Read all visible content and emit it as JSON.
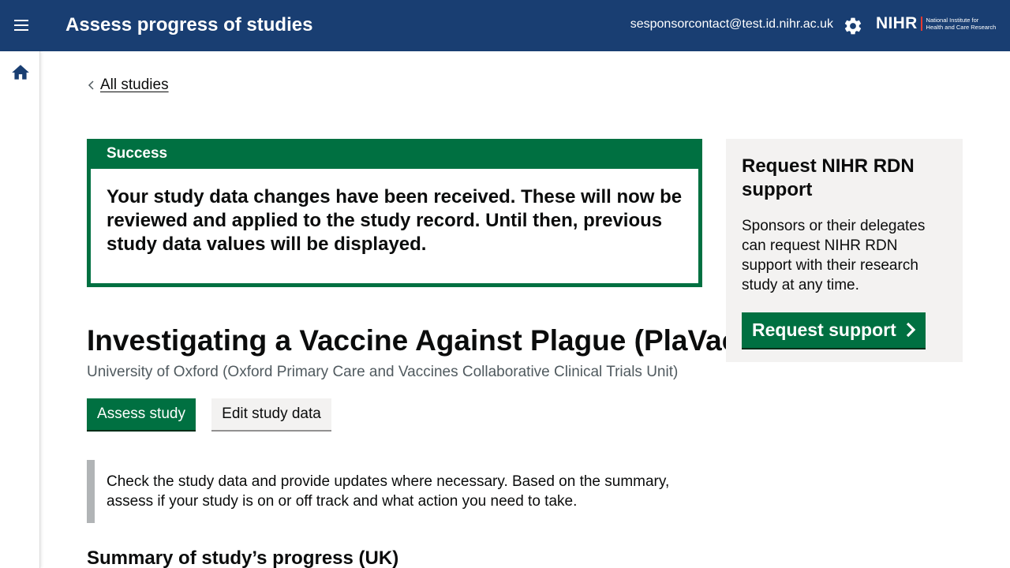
{
  "header": {
    "menu_icon": "hamburger-menu-icon",
    "title": "Assess progress of studies",
    "user_email": "sesponsorcontact@test.id.nihr.ac.uk",
    "settings_icon": "gear-icon",
    "logo": {
      "word": "NIHR",
      "line1": "National Institute for",
      "line2": "Health and Care Research"
    },
    "background_color": "#193e72"
  },
  "sidebar": {
    "home_icon": "home-icon"
  },
  "back_link": {
    "label": "All studies"
  },
  "success_banner": {
    "heading": "Success",
    "message": "Your study data changes have been received. These will now be reviewed and applied to the study record. Until then, previous study data values will be displayed.",
    "color": "#007041"
  },
  "study": {
    "title": "Investigating a Vaccine Against Plague (PlaVac)",
    "organisation": "University of Oxford (Oxford Primary Care and Vaccines Collaborative Clinical Trials Unit)"
  },
  "actions": {
    "assess_label": "Assess study",
    "edit_label": "Edit study data"
  },
  "inset_text": "Check the study data and provide updates where necessary. Based on the summary, assess if your study is on or off track and what action you need to take.",
  "summary_heading": "Summary of study’s progress (UK)",
  "support_panel": {
    "title": "Request NIHR RDN support",
    "text": "Sponsors or their delegates can request NIHR RDN support with their research study at any time.",
    "button_label": "Request support"
  }
}
